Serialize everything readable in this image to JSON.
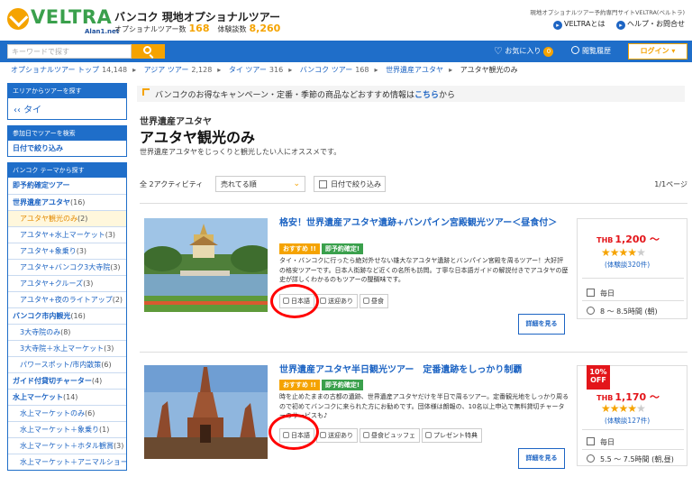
{
  "header": {
    "brand": "VELTRA",
    "brand_sub": "Alan1.net",
    "site_title": "バンコク 現地オプショナルツアー",
    "tours_label": "オプショナルツアー数",
    "tours_count": "168",
    "reviews_label": "体験談数",
    "reviews_count": "8,260",
    "tagline": "現地オプショナルツアー予約専門サイトVELTRA(ベルトラ)",
    "about": "VELTRAとは",
    "help": "ヘルプ・お問合せ"
  },
  "nav": {
    "search_placeholder": "キーワードで探す",
    "favorites": "お気に入り",
    "favorites_count": "0",
    "history": "閲覧履歴",
    "login": "ログイン ▾"
  },
  "breadcrumb": [
    {
      "label": "オプショナルツアー トップ",
      "count": "14,148"
    },
    {
      "label": "アジア ツアー",
      "count": "2,128"
    },
    {
      "label": "タイ ツアー",
      "count": "316"
    },
    {
      "label": "バンコク ツアー",
      "count": "168"
    },
    {
      "label": "世界遺産アユタヤ",
      "count": ""
    },
    {
      "label": "アユタヤ観光のみ",
      "count": ""
    }
  ],
  "sidebar": {
    "area_header": "エリアからツアーを探す",
    "area_value": "‹‹ タイ",
    "date_header": "参加日でツアーを検索",
    "date_label": "日付で絞り込み",
    "theme_header": "バンコク テーマから探す",
    "items": [
      {
        "label": "即予約確定ツアー",
        "count": ""
      },
      {
        "label": "世界遺産アユタヤ",
        "count": "(16)"
      },
      {
        "label": "アユタヤ観光のみ",
        "count": "(2)"
      },
      {
        "label": "アユタヤ+水上マーケット",
        "count": "(3)"
      },
      {
        "label": "アユタヤ+象乗り",
        "count": "(3)"
      },
      {
        "label": "アユタヤ+バンコク3大寺院",
        "count": "(3)"
      },
      {
        "label": "アユタヤ+クルーズ",
        "count": "(3)"
      },
      {
        "label": "アユタヤ+夜のライトアップ",
        "count": "(2)"
      },
      {
        "label": "バンコク市内観光",
        "count": "(16)"
      },
      {
        "label": "3大寺院のみ",
        "count": "(8)"
      },
      {
        "label": "3大寺院＋水上マーケット",
        "count": "(3)"
      },
      {
        "label": "パワースポット/市内散策",
        "count": "(6)"
      },
      {
        "label": "ガイド付貸切チャーター",
        "count": "(4)"
      },
      {
        "label": "水上マーケット",
        "count": "(14)"
      },
      {
        "label": "水上マーケットのみ",
        "count": "(6)"
      },
      {
        "label": "水上マーケット＋象乗り",
        "count": "(1)"
      },
      {
        "label": "水上マーケット＋ホタル観賞",
        "count": "(3)"
      },
      {
        "label": "水上マーケット＋アニマルショー",
        "count": "(4)"
      }
    ]
  },
  "notice": {
    "text": "バンコクのお得なキャンペーン・定番・季節の商品などおすすめ情報は",
    "link": "こちら",
    "suffix": "から"
  },
  "page": {
    "eyebrow": "世界遺産アユタヤ",
    "title": "アユタヤ観光のみ",
    "description": "世界遺産アユタヤをじっくりと観光したい人にオススメです。"
  },
  "sort": {
    "count_label": "全 2アクティビティ",
    "sort_value": "売れてる順",
    "date_filter": "日付で絞り込み",
    "page_count": "1/1ページ"
  },
  "tours": [
    {
      "title": "格安！世界遺産アユタヤ遺跡+バンパイン宮殿観光ツアー＜昼食付＞",
      "badges": [
        "おすすめ !!",
        "即予約確定!"
      ],
      "description": "タイ・バンコクに行ったら絶対外せない雄大なアユタヤ遺跡とバンパイン宮殿を周るツアー！大好評の格安ツアーです。日本人街跡など近くの名所も訪問。丁寧な日本語ガイドの解説付きでアユタヤの歴史が詳しくわかるのもツアーの醍醐味です。",
      "features": [
        "日本語",
        "送迎あり",
        "昼食"
      ],
      "detail": "詳細を見る",
      "currency": "THB",
      "price": "1,200 ～",
      "stars": 4,
      "reviews": "(体験談320件)",
      "frequency": "毎日",
      "duration": "8 ～ 8.5時間 (朝)",
      "discount": ""
    },
    {
      "title": "世界遺産アユタヤ半日観光ツアー　定番遺跡をしっかり制覇",
      "badges": [
        "おすすめ !!",
        "即予約確定!"
      ],
      "description": "時を止めたままの古都の遺跡、世界遺産アユタヤだけを半日で周るツアー。定番観光地をしっかり周るので初めてバンコクに来られた方にお勧めです。団体様は朗報の、10名以上申込で無料貸切チャーターのサービスも♪",
      "features": [
        "日本語",
        "送迎あり",
        "昼食ビュッフェ",
        "プレゼント特典"
      ],
      "detail": "詳細を見る",
      "currency": "THB",
      "price": "1,170 ～",
      "stars": 4,
      "reviews": "(体験談127件)",
      "frequency": "毎日",
      "duration": "5.5 ～ 7.5時間 (朝,昼)",
      "discount": "10% OFF"
    }
  ],
  "colors": {
    "brand_green": "#3aa04c",
    "brand_orange": "#f5a300",
    "nav_blue": "#1f6ec9",
    "link_blue": "#1d64c3",
    "price_red": "#e3151a",
    "annotation_red": "#ff0000"
  }
}
